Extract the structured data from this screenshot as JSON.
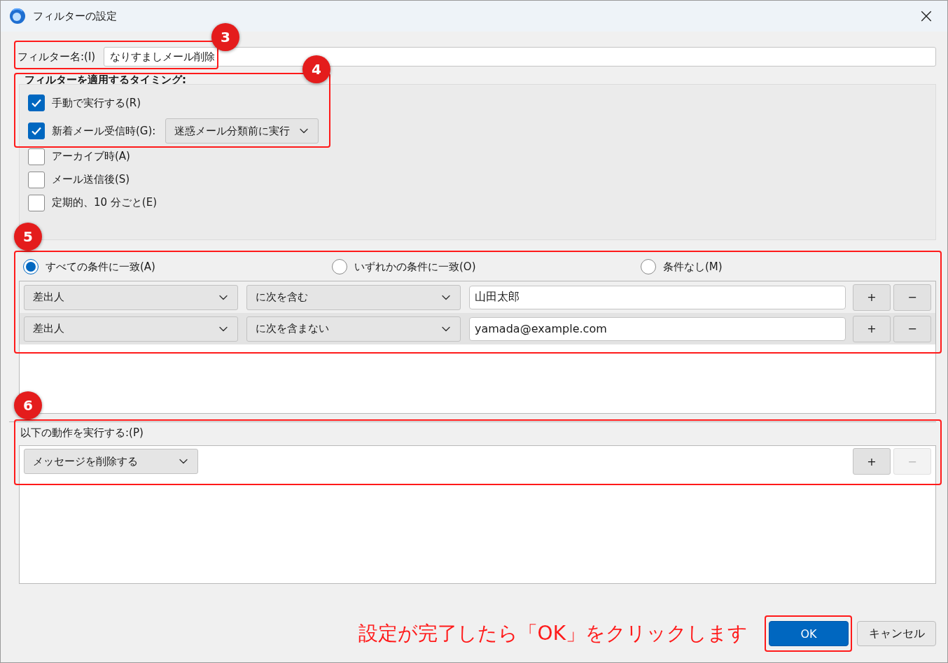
{
  "window": {
    "title": "フィルターの設定",
    "close": "×"
  },
  "filter_name": {
    "label": "フィルター名:(I)",
    "value": "なりすましメール削除"
  },
  "timing": {
    "heading": "フィルターを適用するタイミング:",
    "options": [
      {
        "label": "手動で実行する(R)",
        "checked": true
      },
      {
        "label": "新着メール受信時(G):",
        "checked": true,
        "dropdown": "迷惑メール分類前に実行"
      },
      {
        "label": "アーカイブ時(A)",
        "checked": false
      },
      {
        "label": "メール送信後(S)",
        "checked": false
      },
      {
        "label": "定期的、10 分ごと(E)",
        "checked": false
      }
    ]
  },
  "match": [
    {
      "label": "すべての条件に一致(A)",
      "selected": true
    },
    {
      "label": "いずれかの条件に一致(O)",
      "selected": false
    },
    {
      "label": "条件なし(M)",
      "selected": false
    }
  ],
  "conditions": [
    {
      "field": "差出人",
      "operator": "に次を含む",
      "value": "山田太郎",
      "selected": false,
      "add": "+",
      "remove": "−"
    },
    {
      "field": "差出人",
      "operator": "に次を含まない",
      "value": "yamada@example.com",
      "selected": true,
      "add": "+",
      "remove": "−"
    }
  ],
  "actions": {
    "heading": "以下の動作を実行する:(P)",
    "rows": [
      {
        "action": "メッセージを削除する",
        "add": "+",
        "remove": "−",
        "remove_disabled": true
      }
    ]
  },
  "buttons": [
    {
      "label": "OK",
      "kind": "primary"
    },
    {
      "label": "キャンセル",
      "kind": "secondary"
    }
  ],
  "annotations": {
    "markers": [
      "3",
      "4",
      "5",
      "6"
    ],
    "caption": "設定が完了したら「OK」をクリックします"
  }
}
